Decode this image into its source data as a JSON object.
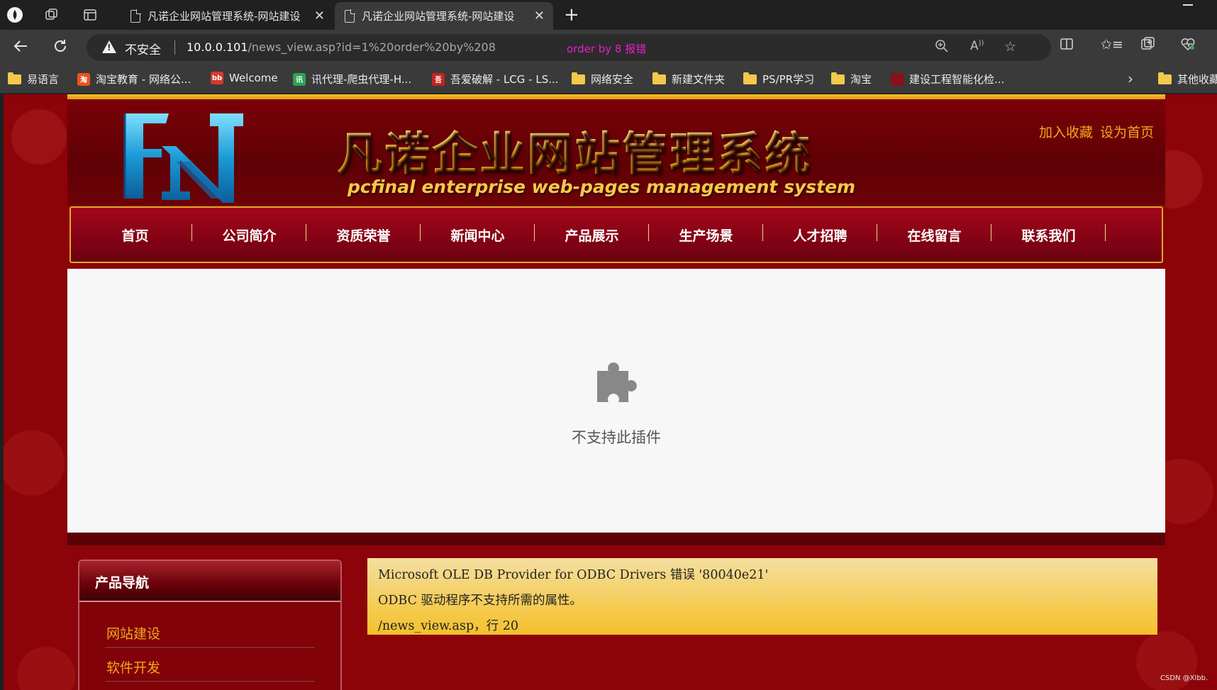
{
  "browser": {
    "tabs": [
      {
        "title": "凡诺企业网站管理系统-网站建设",
        "active": false
      },
      {
        "title": "凡诺企业网站管理系统-网站建设",
        "active": true
      }
    ],
    "security_label": "不安全",
    "url_host": "10.0.0.101",
    "url_path": "/news_view.asp?id=1%20order%20by%208",
    "annotation": "order by 8 报错",
    "bookmarks": [
      {
        "label": "易语言",
        "icon": "folder-icon"
      },
      {
        "label": "淘宝教育 - 网络公...",
        "icon": "taobao-edu-icon"
      },
      {
        "label": "Welcome",
        "icon": "bilibili-icon"
      },
      {
        "label": "讯代理-爬虫代理-H...",
        "icon": "xundaili-icon"
      },
      {
        "label": "吾爱破解 - LCG - LS...",
        "icon": "52pojie-icon"
      },
      {
        "label": "网络安全",
        "icon": "folder-icon"
      },
      {
        "label": "新建文件夹",
        "icon": "folder-icon"
      },
      {
        "label": "PS/PR学习",
        "icon": "folder-icon"
      },
      {
        "label": "淘宝",
        "icon": "folder-icon"
      },
      {
        "label": "建设工程智能化检...",
        "icon": "site-icon"
      }
    ],
    "other_bookmarks": "其他收藏"
  },
  "site": {
    "title": "凡诺企业网站管理系统",
    "subtitle": "pcfinal enterprise web-pages management system",
    "top_links": [
      "加入收藏",
      "设为首页"
    ],
    "nav": [
      "首页",
      "公司简介",
      "资质荣誉",
      "新闻中心",
      "产品展示",
      "生产场景",
      "人才招聘",
      "在线留言",
      "联系我们"
    ],
    "plugin_message": "不支持此插件",
    "side_nav": {
      "title": "产品导航",
      "items": [
        "网站建设",
        "软件开发"
      ]
    },
    "error": {
      "line1": "Microsoft OLE DB Provider for ODBC Drivers 错误 '80040e21'",
      "line2": "ODBC 驱动程序不支持所需的属性。",
      "line3": "/news_view.asp，行 20"
    }
  },
  "watermark": "CSDN @Xlbb."
}
